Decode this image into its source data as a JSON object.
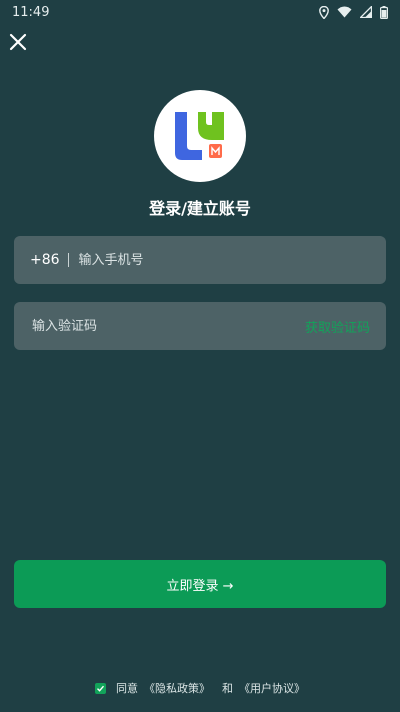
{
  "status_bar": {
    "time": "11:49"
  },
  "title": "登录/建立账号",
  "phone_field": {
    "prefix": "+86",
    "placeholder": "输入手机号"
  },
  "code_field": {
    "placeholder": "输入验证码",
    "get_code_label": "获取验证码"
  },
  "login_button": {
    "label": "立即登录 →"
  },
  "agreement": {
    "prefix": "同意",
    "privacy_link": "《隐私政策》",
    "connector": "和",
    "terms_link": "《用户协议》",
    "checked": true
  },
  "colors": {
    "background": "#1f3f44",
    "field": "#4d6266",
    "accent": "#0c9b56",
    "logo_blue": "#3f66e0",
    "logo_green": "#6fc21f",
    "logo_orange": "#ff6b4a"
  },
  "icons": [
    "close-icon",
    "location-icon",
    "wifi-icon",
    "signal-icon",
    "battery-icon",
    "check-icon",
    "app-logo-icon"
  ]
}
